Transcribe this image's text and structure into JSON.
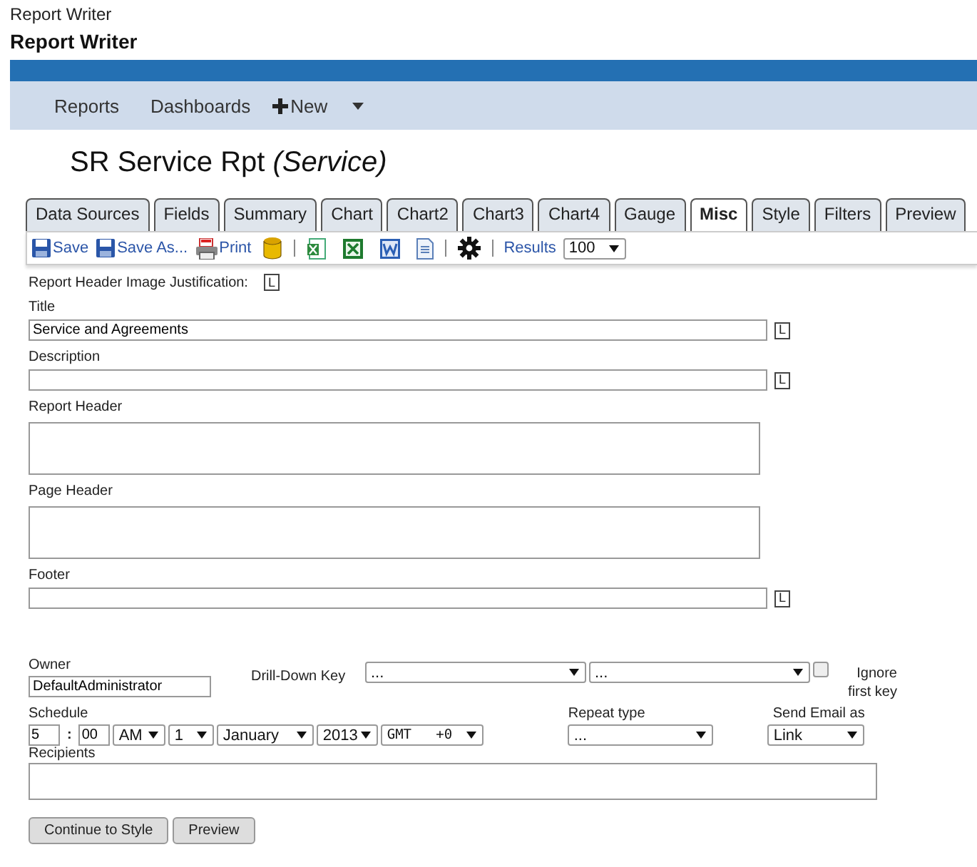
{
  "window": {
    "title": "Report Writer"
  },
  "app_title": "Report Writer",
  "nav": {
    "items": [
      {
        "label": "Reports",
        "kind": "link"
      },
      {
        "label": "Dashboards",
        "kind": "link"
      },
      {
        "label": "New",
        "kind": "new"
      }
    ]
  },
  "report_title": {
    "name": "SR Service Rpt",
    "category": "(Service)"
  },
  "tabs": [
    {
      "label": "Data Sources",
      "selected": false
    },
    {
      "label": "Fields",
      "selected": false
    },
    {
      "label": "Summary",
      "selected": false
    },
    {
      "label": "Chart",
      "selected": false
    },
    {
      "label": "Chart2",
      "selected": false
    },
    {
      "label": "Chart3",
      "selected": false
    },
    {
      "label": "Chart4",
      "selected": false
    },
    {
      "label": "Gauge",
      "selected": false
    },
    {
      "label": "Misc",
      "selected": true
    },
    {
      "label": "Style",
      "selected": false
    },
    {
      "label": "Filters",
      "selected": false
    },
    {
      "label": "Preview",
      "selected": false
    }
  ],
  "toolbar": {
    "items": [
      {
        "kind": "save",
        "label": "Save"
      },
      {
        "kind": "save",
        "label": "Save As..."
      },
      {
        "kind": "print",
        "label": "Print"
      },
      {
        "kind": "sql"
      },
      {
        "kind": "sep"
      },
      {
        "kind": "csv"
      },
      {
        "kind": "excel"
      },
      {
        "kind": "word"
      },
      {
        "kind": "doc"
      },
      {
        "kind": "sep"
      },
      {
        "kind": "gear"
      },
      {
        "kind": "sep"
      }
    ],
    "results_label": "Results",
    "results_value": "100"
  },
  "image_justification": {
    "label": "Report Header Image Justification:",
    "justify": "L"
  },
  "fields": [
    {
      "label": "Title",
      "kind": "line",
      "value": "Service and Agreements",
      "justify": "L"
    },
    {
      "label": "Description",
      "kind": "line",
      "justify": "L"
    },
    {
      "label": "Report Header",
      "kind": "area"
    },
    {
      "label": "Page Header",
      "kind": "area"
    },
    {
      "label": "Footer",
      "kind": "line",
      "justify": "L"
    }
  ],
  "owner": {
    "label": "Owner",
    "value": "DefaultAdministrator"
  },
  "drill_down": {
    "label": "Drill-Down Key",
    "first": "...",
    "second": "...",
    "ignore_label": "Ignore first key",
    "ignore_checked": false
  },
  "schedule": {
    "label": "Schedule",
    "hour": "5",
    "minute_separator": ":",
    "minute": "00",
    "ampm": "AM",
    "day": "1",
    "month": "January",
    "year": "2013",
    "timezone": "GMT   +0"
  },
  "repeat_type": {
    "label": "Repeat type",
    "value": "..."
  },
  "send_email": {
    "label": "Send Email as",
    "value": "Link"
  },
  "recipients": {
    "label": "Recipients"
  },
  "buttons": [
    "Continue to Style",
    "Preview"
  ]
}
